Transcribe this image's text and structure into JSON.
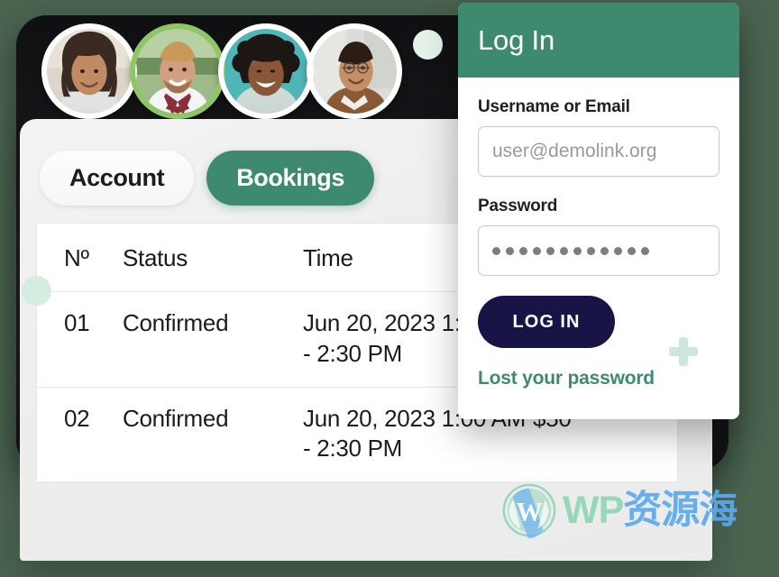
{
  "colors": {
    "brand_green": "#3d8a6f",
    "mint": "#d5ece1",
    "navy": "#191446",
    "page_background": "#4a6450",
    "device_dark": "#17171a",
    "avatar_ring_active": "#8cc665"
  },
  "avatars": [
    {
      "name": "avatar-user-1",
      "ringed": false
    },
    {
      "name": "avatar-user-2",
      "ringed": true
    },
    {
      "name": "avatar-user-3",
      "ringed": false
    },
    {
      "name": "avatar-user-4",
      "ringed": false
    }
  ],
  "tabs": [
    {
      "label": "Account",
      "active": false
    },
    {
      "label": "Bookings",
      "active": true
    }
  ],
  "table": {
    "columns": [
      "Nº",
      "Status",
      "Time",
      ""
    ],
    "rows": [
      {
        "no": "01",
        "status": "Confirmed",
        "time": "Jun 20, 2023 1:00 AM - 2:30 PM",
        "price": ""
      },
      {
        "no": "02",
        "status": "Confirmed",
        "time": "Jun 20, 2023 1:00 AM - 2:30 PM",
        "price": "$50"
      }
    ]
  },
  "login": {
    "title": "Log In",
    "username_label": "Username or Email",
    "username_value": "",
    "username_placeholder": "user@demolink.org",
    "password_label": "Password",
    "password_dots": 12,
    "submit_label": "LOG IN",
    "lost_password_label": "Lost your password"
  },
  "watermark": {
    "english": "WP",
    "chinese": "资源海",
    "icon": "wordpress-icon"
  }
}
